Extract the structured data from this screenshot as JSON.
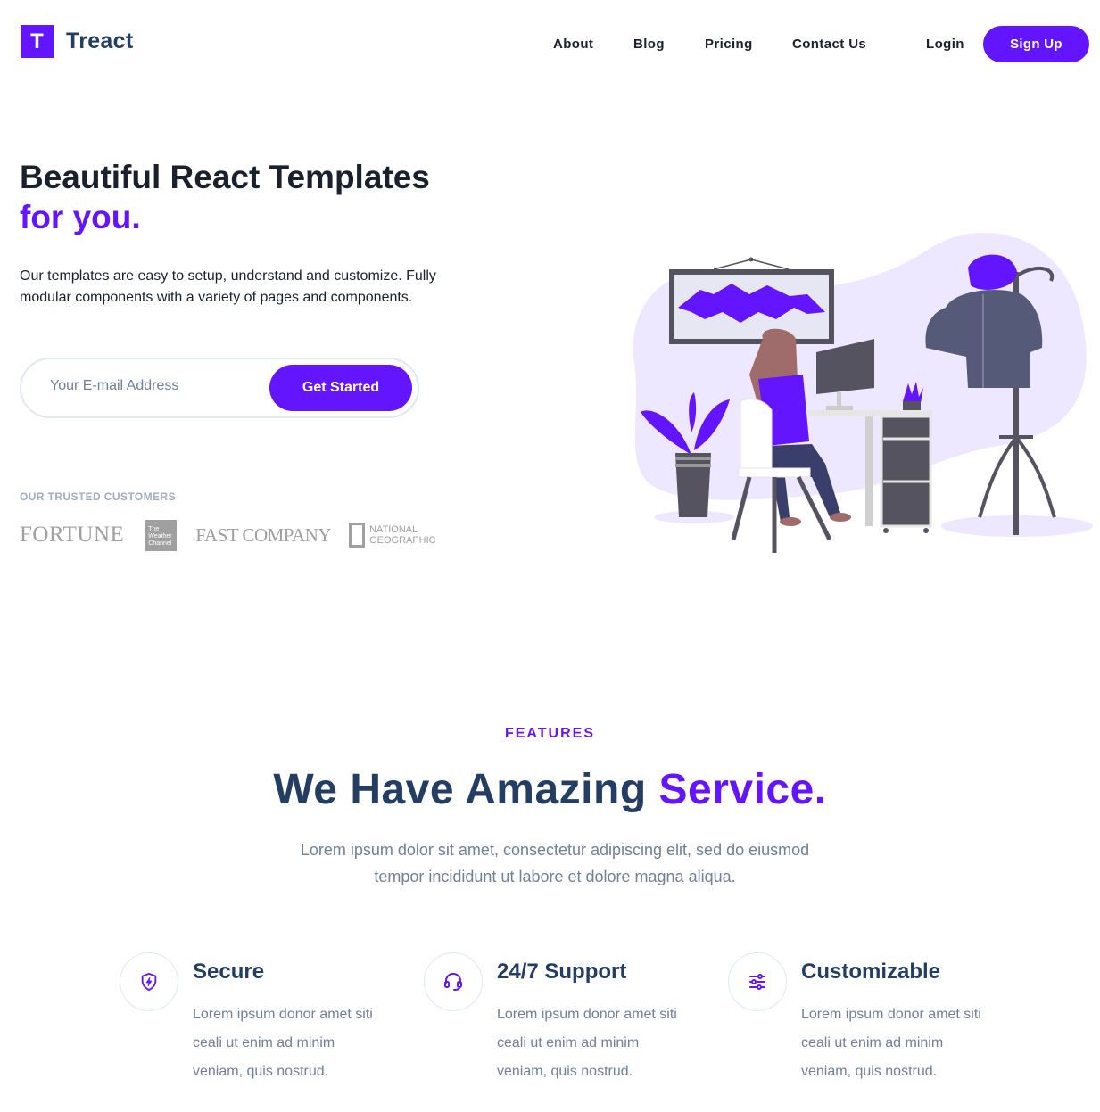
{
  "brand": {
    "logo_letter": "T",
    "name": "Treact",
    "accent_color": "#6415ff",
    "text_color": "#243e63"
  },
  "nav": {
    "links": [
      "About",
      "Blog",
      "Pricing",
      "Contact Us"
    ],
    "login": "Login",
    "signup": "Sign Up"
  },
  "hero": {
    "title_line1": "Beautiful React Templates",
    "title_line2": "for you.",
    "description": "Our templates are easy to setup, understand and customize. Fully modular components with a variety of pages and components.",
    "email_placeholder": "Your E-mail Address",
    "cta": "Get Started",
    "trusted_label": "OUR TRUSTED CUSTOMERS",
    "customers": {
      "fortune": "FORTUNE",
      "weather_channel": [
        "The",
        "Weather",
        "Channel"
      ],
      "fast_company": "FAST COMPANY",
      "national_geographic": [
        "NATIONAL",
        "GEOGRAPHIC"
      ]
    }
  },
  "features": {
    "subheading": "FEATURES",
    "heading_main": "We Have Amazing",
    "heading_accent": "Service.",
    "description": "Lorem ipsum dolor sit amet, consectetur adipiscing elit, sed do eiusmod tempor incididunt ut labore et dolore magna aliqua.",
    "cards": [
      {
        "icon": "shield-icon",
        "title": "Secure",
        "description": "Lorem ipsum donor amet siti ceali ut enim ad minim veniam, quis nostrud."
      },
      {
        "icon": "headset-icon",
        "title": "24/7 Support",
        "description": "Lorem ipsum donor amet siti ceali ut enim ad minim veniam, quis nostrud."
      },
      {
        "icon": "sliders-icon",
        "title": "Customizable",
        "description": "Lorem ipsum donor amet siti ceali ut enim ad minim veniam, quis nostrud."
      }
    ]
  }
}
